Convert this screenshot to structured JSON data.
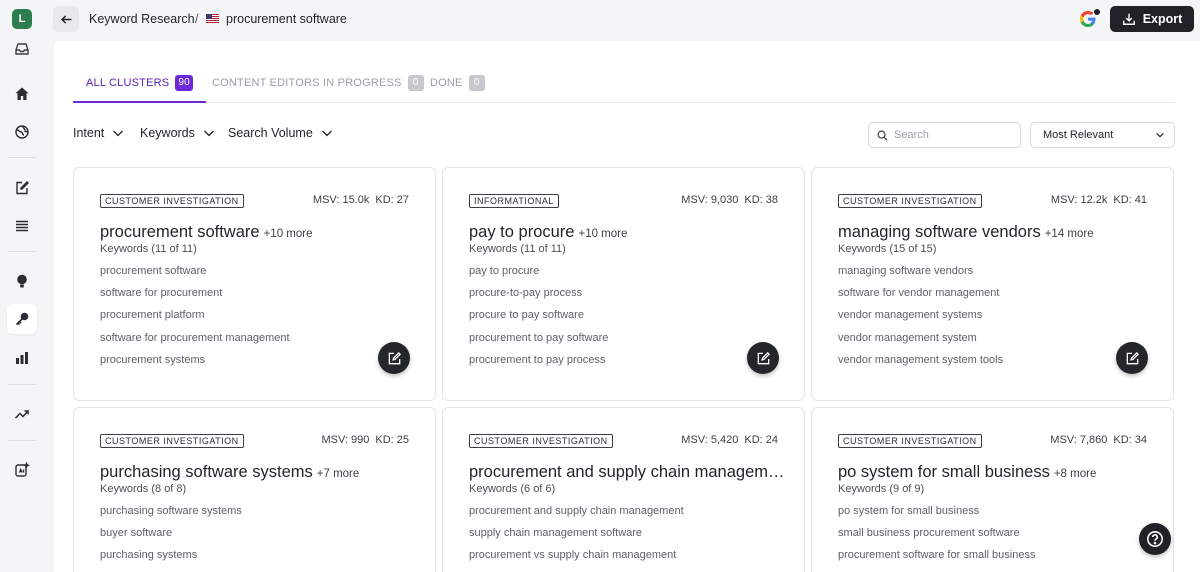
{
  "sidebar": {
    "avatar_letter": "L",
    "avatar_color": "#2e7d4f",
    "icons": [
      "inbox-icon",
      "home-icon",
      "globe-icon",
      "edit-document-icon",
      "list-icon",
      "lightbulb-icon",
      "key-icon",
      "bar-chart-icon",
      "trending-icon",
      "ai-edit-icon"
    ],
    "active_icon": "key-icon"
  },
  "header": {
    "breadcrumb_parent": "Keyword Research",
    "breadcrumb_separator": "/",
    "breadcrumb_current": "procurement software",
    "flag_icon": "us-flag-icon",
    "export_label": "Export"
  },
  "tabs": [
    {
      "label": "ALL CLUSTERS",
      "count": "90",
      "active": true
    },
    {
      "label": "CONTENT EDITORS IN PROGRESS",
      "count": "0",
      "active": false
    },
    {
      "label": "DONE",
      "count": "0",
      "active": false
    }
  ],
  "filters": {
    "intent": "Intent",
    "keywords": "Keywords",
    "search_volume": "Search Volume",
    "search_placeholder": "Search",
    "sort_value": "Most Relevant"
  },
  "cards": [
    {
      "intent": "CUSTOMER INVESTIGATION",
      "msv": "MSV: 15.0k",
      "kd": "KD: 27",
      "title": "procurement software",
      "more": "+10 more",
      "keyword_count": "Keywords (11 of 11)",
      "keywords": [
        "procurement software",
        "software for procurement",
        "procurement platform",
        "software for procurement management",
        "procurement systems"
      ]
    },
    {
      "intent": "INFORMATIONAL",
      "msv": "MSV: 9,030",
      "kd": "KD: 38",
      "title": "pay to procure",
      "more": "+10 more",
      "keyword_count": "Keywords (11 of 11)",
      "keywords": [
        "pay to procure",
        "procure-to-pay process",
        "procure to pay software",
        "procurement to pay software",
        "procurement to pay process"
      ]
    },
    {
      "intent": "CUSTOMER INVESTIGATION",
      "msv": "MSV: 12.2k",
      "kd": "KD: 41",
      "title": "managing software vendors",
      "more": "+14 more",
      "keyword_count": "Keywords (15 of 15)",
      "keywords": [
        "managing software vendors",
        "software for vendor management",
        "vendor management systems",
        "vendor management system",
        "vendor management system tools"
      ]
    },
    {
      "intent": "CUSTOMER INVESTIGATION",
      "msv": "MSV: 990",
      "kd": "KD: 25",
      "title": "purchasing software systems",
      "more": "+7 more",
      "keyword_count": "Keywords (8 of 8)",
      "keywords": [
        "purchasing software systems",
        "buyer software",
        "purchasing systems"
      ]
    },
    {
      "intent": "CUSTOMER INVESTIGATION",
      "msv": "MSV: 5,420",
      "kd": "KD: 24",
      "title": "procurement and supply chain management",
      "more": "",
      "keyword_count": "Keywords (6 of 6)",
      "keywords": [
        "procurement and supply chain management",
        "supply chain management software",
        "procurement vs supply chain management"
      ]
    },
    {
      "intent": "CUSTOMER INVESTIGATION",
      "msv": "MSV: 7,860",
      "kd": "KD: 34",
      "title": "po system for small business",
      "more": "+8 more",
      "keyword_count": "Keywords (9 of 9)",
      "keywords": [
        "po system for small business",
        "small business procurement software",
        "procurement software for small business"
      ]
    }
  ],
  "colors": {
    "accent": "#6d28d9",
    "dark_button": "#1f2328"
  }
}
